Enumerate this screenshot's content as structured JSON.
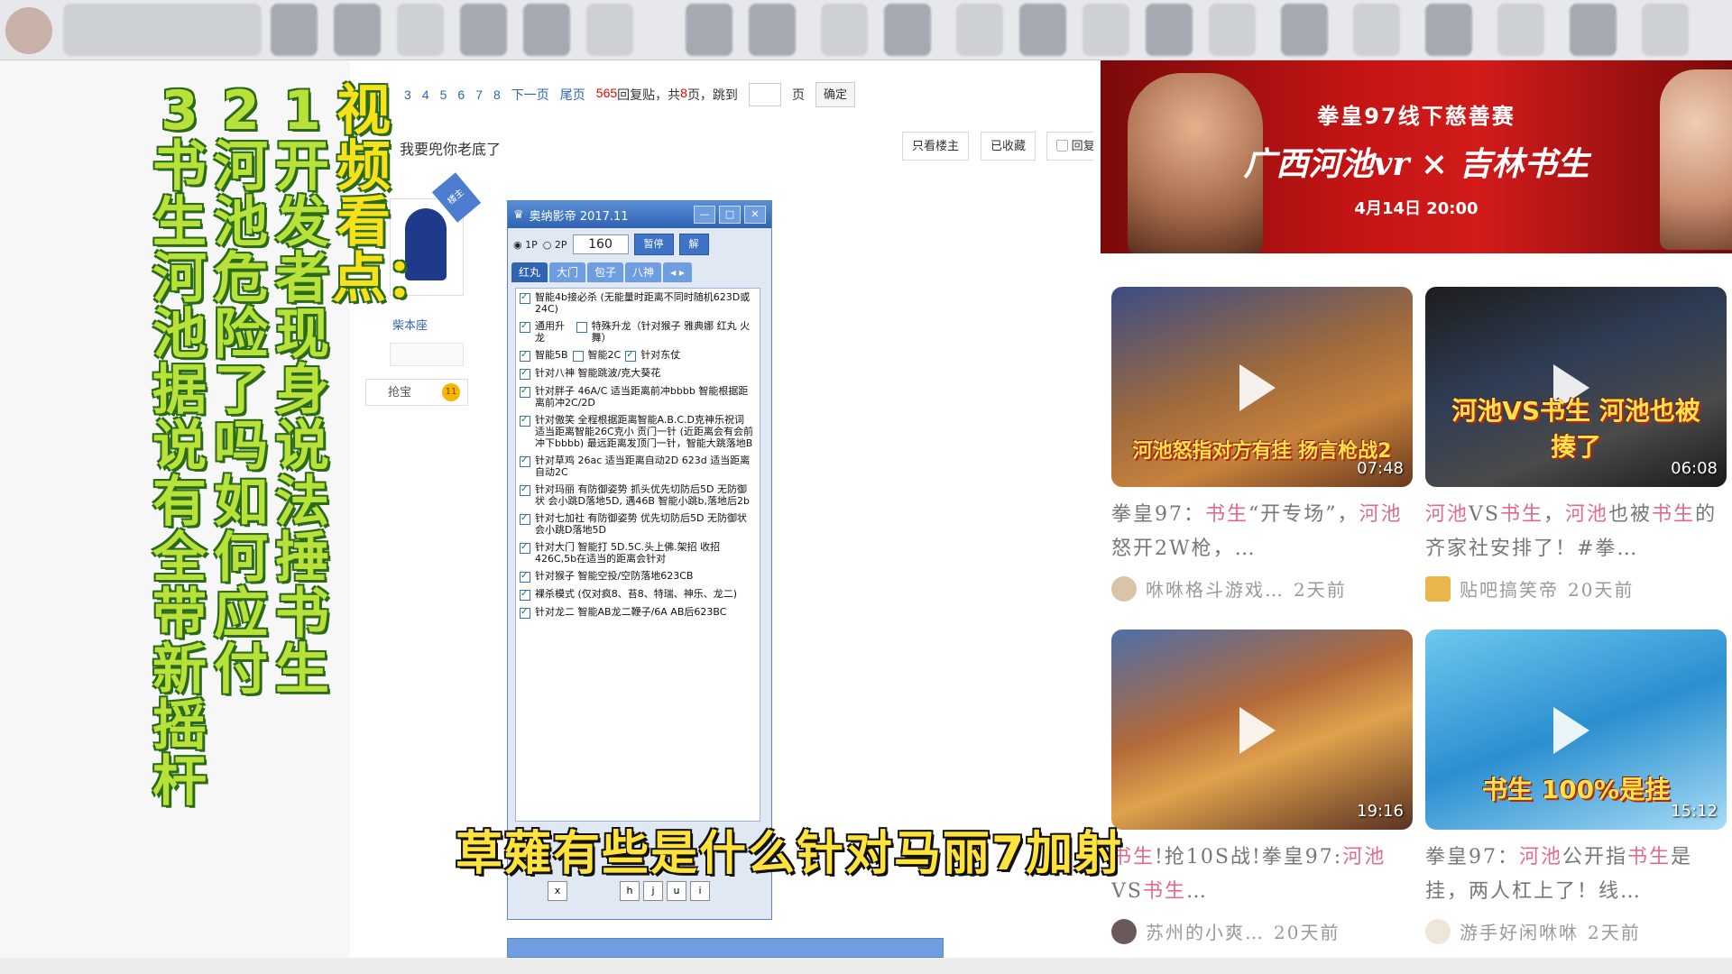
{
  "forum": {
    "pager": {
      "pages": [
        "3",
        "4",
        "5",
        "6",
        "7",
        "8"
      ],
      "next": "下一页",
      "last": "尾页",
      "reply_count": "565",
      "reply_label": "回复贴，共",
      "page_total": "8",
      "page_unit": "页，跳到",
      "jump_suffix": "页",
      "confirm": "确定"
    },
    "post_title": "我要兜你老底了",
    "buttons": {
      "only_op": "只看楼主",
      "favorited": "已收藏",
      "reply": "回复"
    },
    "op_ribbon": "楼主",
    "username": "柴本座",
    "rob_label": "抢宝",
    "rob_count": "11"
  },
  "cheat_window": {
    "title": "奥纳影帝 2017.11",
    "radio_1p": "1P",
    "radio_2p": "2P",
    "value": "160",
    "pause": "暂停",
    "unlock": "解",
    "tabs": [
      "红丸",
      "大门",
      "包子",
      "八神"
    ],
    "options": [
      {
        "checked": true,
        "text": "智能4b接必杀 (无能量时距离不同时随机623D或24C)"
      },
      {
        "checked": true,
        "text": "通用升龙"
      },
      {
        "checked": false,
        "text": "特殊升龙（针对猴子 雅典娜 红丸 火舞）"
      },
      {
        "checked": true,
        "text": "智能5B"
      },
      {
        "checked": false,
        "text": "智能2C"
      },
      {
        "checked": true,
        "text": "针对东仗"
      },
      {
        "checked": true,
        "text": "针对八神 智能跳波/克大葵花"
      },
      {
        "checked": true,
        "text": "针对胖子 46A/C 适当距离前冲bbbb 智能根据距离前冲2C/2D"
      },
      {
        "checked": true,
        "text": "针对傲笑 全程根据距离智能A.B.C.D克神乐祝词 适当距离智能26C克小 贡门一针 (近距离会有会前冲下bbbb) 最远距离发顶门一针，智能大跳落地B"
      },
      {
        "checked": true,
        "text": "针对草鸡 26ac 适当距离自动2D 623d 适当距离自动2C"
      },
      {
        "checked": true,
        "text": "针对玛丽 有防御姿势 抓头优先切防后5D 无防御状 会小跳D落地5D, 遇46B 智能小跳b,落地后2b"
      },
      {
        "checked": true,
        "text": "针对七加社 有防御姿势 优先切防后5D 无防御状 会小跳D落地5D"
      },
      {
        "checked": true,
        "text": "针对大门 智能打 5D.5C.头上佛.架招 收招 426C,5b在适当的距离会针对"
      },
      {
        "checked": true,
        "text": "针对猴子 智能空投/空防落地623CB"
      },
      {
        "checked": true,
        "text": "裸杀模式 (仅对疯8、苔8、特瑞、神乐、龙二)"
      },
      {
        "checked": true,
        "text": "针对龙二 智能AB龙二鞭子/6A AB后623BC"
      }
    ],
    "keys": [
      "x",
      "h",
      "j",
      "u",
      "i"
    ]
  },
  "right_panel": {
    "banner": {
      "line1": "拳皇97线下慈善赛",
      "line2": "广西河池vr × 吉林书生",
      "line3": "4月14日 20:00"
    },
    "videos": [
      {
        "thumb_text": "河池怒指对方有挂 扬言枪战2",
        "duration": "07:48",
        "title_parts": [
          "拳皇97：",
          "书生",
          "“开专场”，",
          "河池",
          "怒开2W枪，…"
        ],
        "uploader": "咻咻格斗游戏…",
        "time": "2天前"
      },
      {
        "thumb_text": "河池VS书生 河池也被揍了",
        "duration": "06:08",
        "title_parts": [
          "河池",
          "VS",
          "书生",
          "，",
          "河池",
          "也被",
          "书生",
          "的齐家社安排了！#拳…"
        ],
        "uploader": "贴吧搞笑帝",
        "time": "20天前"
      },
      {
        "thumb_text": "",
        "duration": "19:16",
        "title_parts": [
          "书生",
          "!抢10S",
          "战!拳皇97:",
          "河池",
          "VS",
          "书生",
          "…"
        ],
        "uploader": "苏州的小爽…",
        "time": "20天前"
      },
      {
        "thumb_text": "书生 100%是挂",
        "duration": "15:12",
        "title_parts": [
          "拳皇97：",
          "河池",
          "公开指",
          "书生",
          "是挂，两人杠上了！线…"
        ],
        "uploader": "游手好闲咻咻",
        "time": "2天前"
      }
    ]
  },
  "video_overlay": {
    "col_title": "视频看点：",
    "col_1": "1开发者现身说法捶书生",
    "col_2": "2河池危险了吗如何应付",
    "col_3": "3书生河池据说有全带新摇杆",
    "subtitle": "草薙有些是什么针对马丽7加射"
  },
  "colors": {
    "overlay_yellow": "#f6e11a",
    "accent_red": "#c41414",
    "highlight_pink": "#e06b8b"
  }
}
